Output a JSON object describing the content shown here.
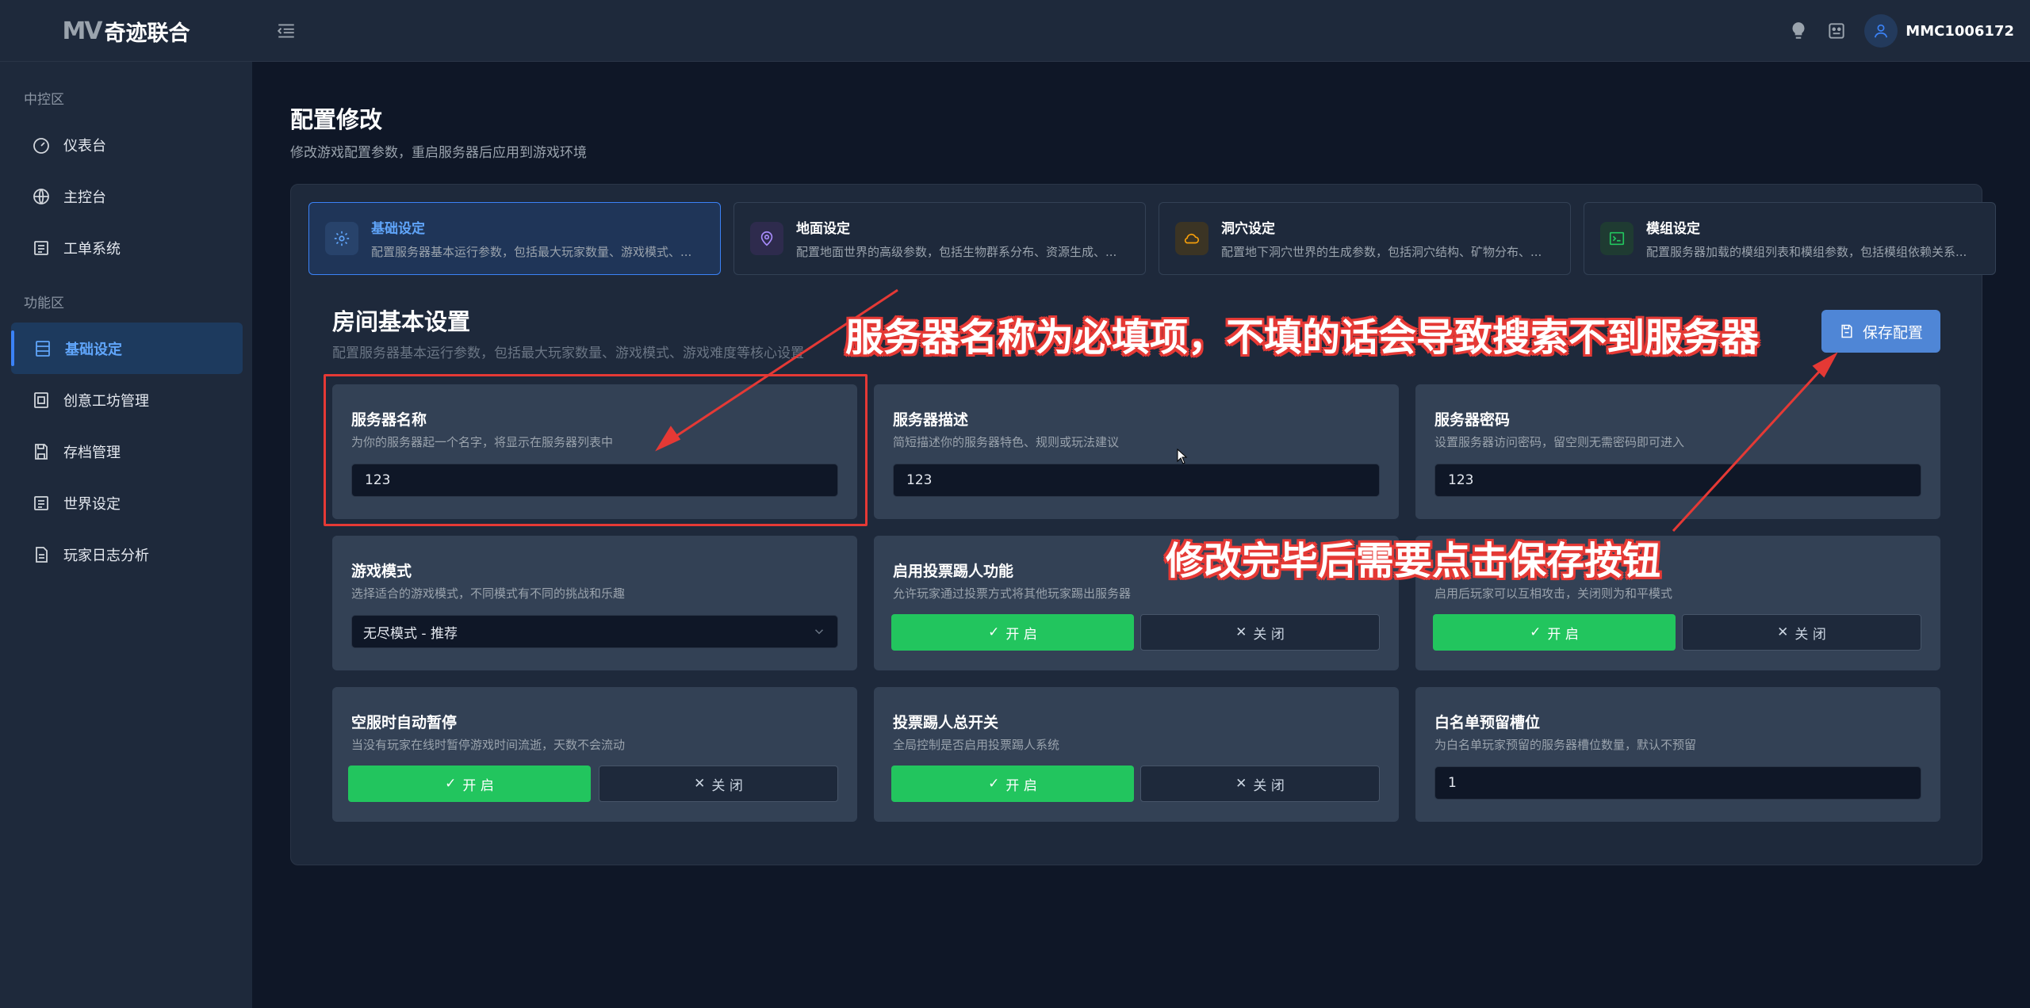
{
  "app": {
    "logo_mark": "MV",
    "logo_name": "奇迹联合",
    "username": "MMC1006172"
  },
  "sidebar": {
    "sections": [
      {
        "label": "中控区",
        "items": [
          {
            "label": "仪表台",
            "icon": "gauge-icon"
          },
          {
            "label": "主控台",
            "icon": "globe-icon"
          },
          {
            "label": "工单系统",
            "icon": "list-icon"
          }
        ]
      },
      {
        "label": "功能区",
        "items": [
          {
            "label": "基础设定",
            "icon": "server-icon",
            "active": true
          },
          {
            "label": "创意工坊管理",
            "icon": "workshop-icon"
          },
          {
            "label": "存档管理",
            "icon": "save-icon"
          },
          {
            "label": "世界设定",
            "icon": "list-icon"
          },
          {
            "label": "玩家日志分析",
            "icon": "file-icon"
          }
        ]
      }
    ]
  },
  "page": {
    "title": "配置修改",
    "subtitle": "修改游戏配置参数，重启服务器后应用到游戏环境"
  },
  "tabs": [
    {
      "title": "基础设定",
      "desc": "配置服务器基本运行参数，包括最大玩家数量、游戏模式、...",
      "icon": "gear-icon",
      "active": true
    },
    {
      "title": "地面设定",
      "desc": "配置地面世界的高级参数，包括生物群系分布、资源生成、...",
      "icon": "map-pin-icon"
    },
    {
      "title": "洞穴设定",
      "desc": "配置地下洞穴世界的生成参数，包括洞穴结构、矿物分布、...",
      "icon": "cloud-icon"
    },
    {
      "title": "模组设定",
      "desc": "配置服务器加载的模组列表和模组参数，包括模组依赖关系...",
      "icon": "terminal-icon"
    }
  ],
  "section": {
    "title": "房间基本设置",
    "subtitle": "配置服务器基本运行参数，包括最大玩家数量、游戏模式、游戏难度等核心设置",
    "save_label": "保存配置"
  },
  "fields": {
    "server_name": {
      "title": "服务器名称",
      "desc": "为你的服务器起一个名字，将显示在服务器列表中",
      "value": "123"
    },
    "server_desc": {
      "title": "服务器描述",
      "desc": "简短描述你的服务器特色、规则或玩法建议",
      "value": "123"
    },
    "server_password": {
      "title": "服务器密码",
      "desc": "设置服务器访问密码，留空则无需密码即可进入",
      "value": "123"
    },
    "game_mode": {
      "title": "游戏模式",
      "desc": "选择适合的游戏模式，不同模式有不同的挑战和乐趣",
      "value": "无尽模式 - 推荐"
    },
    "vote_kick": {
      "title": "启用投票踢人功能",
      "desc": "允许玩家通过投票方式将其他玩家踢出服务器"
    },
    "pvp": {
      "desc": "启用后玩家可以互相攻击，关闭则为和平模式"
    },
    "auto_pause": {
      "title": "空服时自动暂停",
      "desc": "当没有玩家在线时暂停游戏时间流逝，天数不会流动"
    },
    "vote_kick_master": {
      "title": "投票踢人总开关",
      "desc": "全局控制是否启用投票踢人系统"
    },
    "whitelist_slots": {
      "title": "白名单预留槽位",
      "desc": "为白名单玩家预留的服务器槽位数量，默认不预留",
      "value": "1"
    }
  },
  "toggle": {
    "on_label": "开 启",
    "off_label": "关 闭"
  },
  "annotations": {
    "name_required": "服务器名称为必填项，不填的话会导致搜索不到服务器",
    "click_save": "修改完毕后需要点击保存按钮",
    "color": "#e53935"
  },
  "colors": {
    "accent": "#3b82f6",
    "toggle_on": "#22c55e",
    "save_button": "#4f86d6"
  }
}
